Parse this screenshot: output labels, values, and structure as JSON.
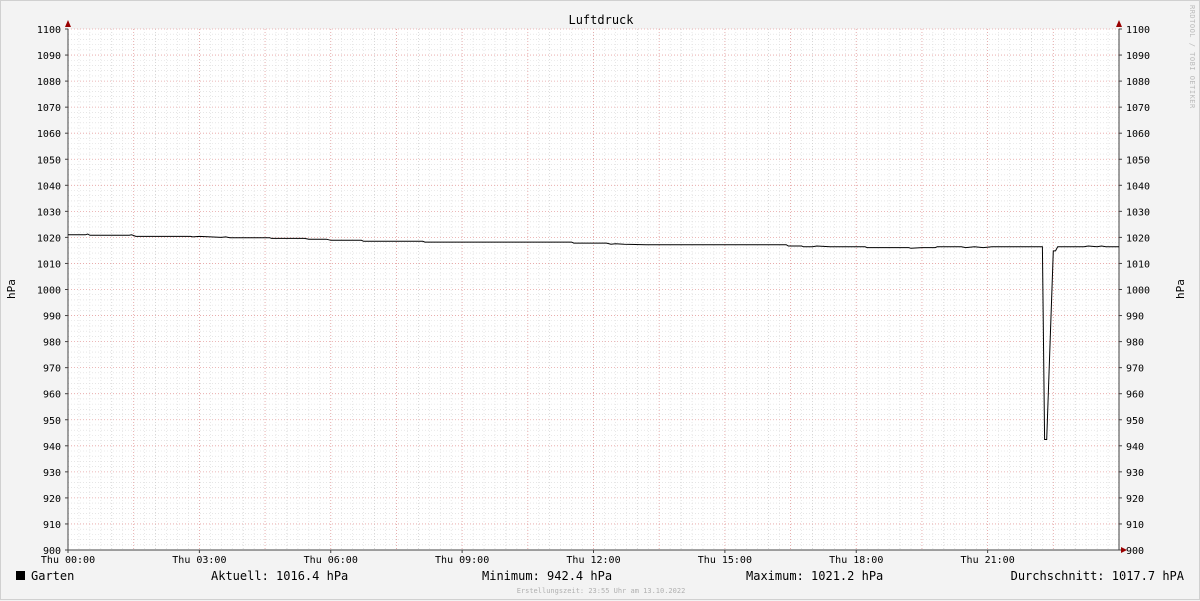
{
  "chart_data": {
    "type": "line",
    "title": "Luftdruck",
    "ylabel": "hPa",
    "ylabel_right": "hPa",
    "ylim": [
      900,
      1100
    ],
    "yticks": [
      900,
      910,
      920,
      930,
      940,
      950,
      960,
      970,
      980,
      990,
      1000,
      1010,
      1020,
      1030,
      1040,
      1050,
      1060,
      1070,
      1080,
      1090,
      1100
    ],
    "xlim_hours": [
      0,
      24
    ],
    "xticks": [
      {
        "hour": 0,
        "label": "Thu 00:00"
      },
      {
        "hour": 3,
        "label": "Thu 03:00"
      },
      {
        "hour": 6,
        "label": "Thu 06:00"
      },
      {
        "hour": 9,
        "label": "Thu 09:00"
      },
      {
        "hour": 12,
        "label": "Thu 12:00"
      },
      {
        "hour": 15,
        "label": "Thu 15:00"
      },
      {
        "hour": 18,
        "label": "Thu 18:00"
      },
      {
        "hour": 21,
        "label": "Thu 21:00"
      }
    ],
    "grid": true,
    "series": [
      {
        "name": "Garten",
        "color": "#000000",
        "points": [
          [
            0.0,
            1021.0
          ],
          [
            0.4,
            1021.0
          ],
          [
            0.45,
            1021.3
          ],
          [
            0.5,
            1020.8
          ],
          [
            1.4,
            1020.8
          ],
          [
            1.45,
            1021.0
          ],
          [
            1.55,
            1020.4
          ],
          [
            2.8,
            1020.4
          ],
          [
            2.85,
            1020.2
          ],
          [
            3.0,
            1020.4
          ],
          [
            3.5,
            1020.0
          ],
          [
            3.6,
            1020.2
          ],
          [
            3.7,
            1019.9
          ],
          [
            4.6,
            1019.9
          ],
          [
            4.65,
            1019.6
          ],
          [
            5.4,
            1019.6
          ],
          [
            5.5,
            1019.3
          ],
          [
            5.9,
            1019.3
          ],
          [
            6.0,
            1018.9
          ],
          [
            6.7,
            1018.9
          ],
          [
            6.75,
            1018.5
          ],
          [
            8.1,
            1018.5
          ],
          [
            8.15,
            1018.2
          ],
          [
            11.5,
            1018.2
          ],
          [
            11.55,
            1017.8
          ],
          [
            12.3,
            1017.8
          ],
          [
            12.4,
            1017.4
          ],
          [
            12.5,
            1017.6
          ],
          [
            12.7,
            1017.4
          ],
          [
            13.2,
            1017.2
          ],
          [
            16.4,
            1017.2
          ],
          [
            16.45,
            1016.7
          ],
          [
            16.75,
            1016.7
          ],
          [
            16.8,
            1016.4
          ],
          [
            17.0,
            1016.4
          ],
          [
            17.1,
            1016.7
          ],
          [
            17.4,
            1016.4
          ],
          [
            18.2,
            1016.4
          ],
          [
            18.25,
            1016.1
          ],
          [
            19.2,
            1016.1
          ],
          [
            19.25,
            1015.8
          ],
          [
            19.5,
            1016.1
          ],
          [
            19.8,
            1016.1
          ],
          [
            19.85,
            1016.4
          ],
          [
            20.4,
            1016.4
          ],
          [
            20.5,
            1016.1
          ],
          [
            20.7,
            1016.4
          ],
          [
            20.9,
            1016.1
          ],
          [
            21.1,
            1016.4
          ],
          [
            21.3,
            1016.4
          ],
          [
            22.25,
            1016.4
          ],
          [
            22.3,
            942.4
          ],
          [
            22.35,
            942.4
          ],
          [
            22.5,
            1014.8
          ],
          [
            22.55,
            1014.8
          ],
          [
            22.6,
            1016.4
          ],
          [
            23.2,
            1016.4
          ],
          [
            23.3,
            1016.7
          ],
          [
            23.5,
            1016.4
          ],
          [
            23.6,
            1016.7
          ],
          [
            23.7,
            1016.4
          ],
          [
            24.0,
            1016.4
          ]
        ]
      }
    ]
  },
  "legend": {
    "series_name": "Garten",
    "aktuell": "Aktuell: 1016.4 hPa",
    "minimum": "Minimum: 942.4 hPa",
    "maximum": "Maximum: 1021.2 hPa",
    "durchschnitt": "Durchschnitt: 1017.7 hPA"
  },
  "watermark": "RRDTOOL / TOBI OETIKER",
  "footer": "Erstellungszeit: 23:55 Uhr am 13.10.2022",
  "colors": {
    "background": "#f3f3f3",
    "canvas": "#ffffff",
    "minor_grid": "#d8d8d8",
    "major_grid": "#e6a0a0",
    "line": "#000000",
    "axis": "#444444",
    "arrow": "#990000"
  }
}
